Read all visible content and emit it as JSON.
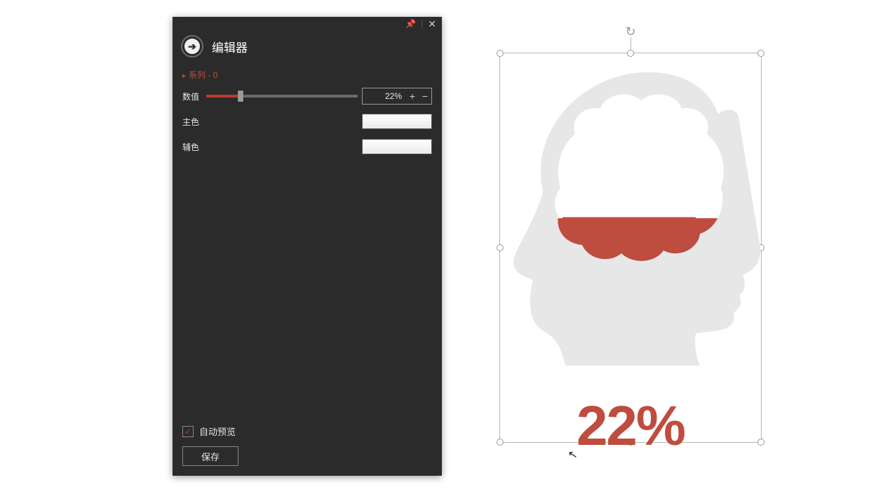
{
  "panel": {
    "title": "编辑器",
    "series_label": "系列 - 0",
    "value_label": "数值",
    "value_text": "22%",
    "value_number": 22,
    "main_color_label": "主色",
    "main_color": "#ffffff",
    "aux_color_label": "辅色",
    "aux_color": "#ffffff",
    "auto_preview_label": "自动预览",
    "auto_preview_checked": true,
    "save_label": "保存"
  },
  "chart_data": {
    "type": "pictorial-fill",
    "value": 22,
    "unit": "%",
    "display_label": "22%",
    "fill_color": "#be4c3f",
    "shape_color": "#e7e7e7",
    "container_color": "#ffffff",
    "description": "Human head silhouette with brain outline; brain filled 22% from bottom"
  }
}
